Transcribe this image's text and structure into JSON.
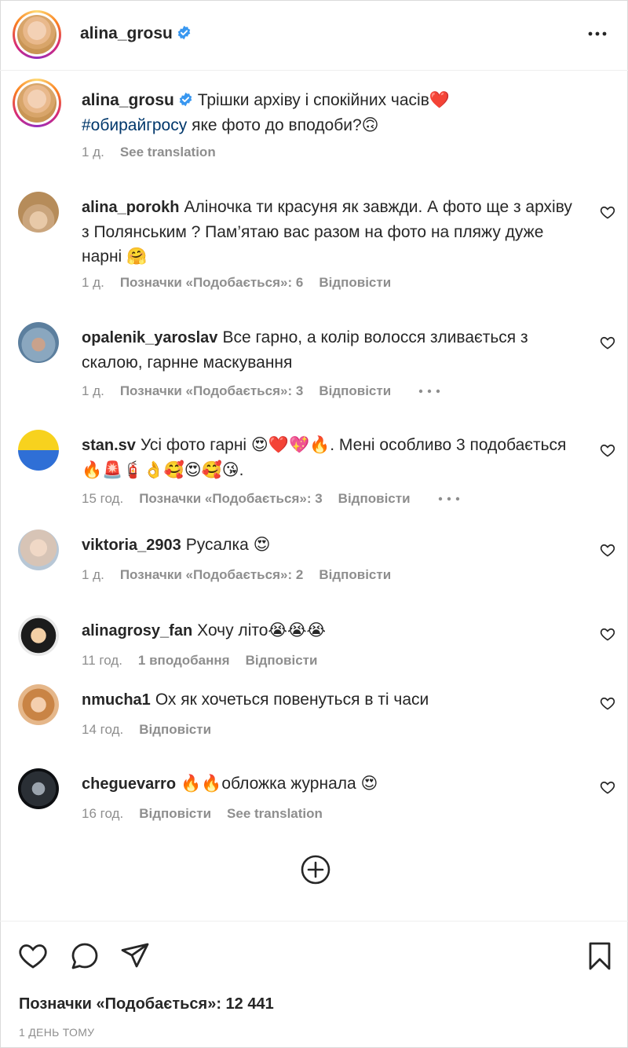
{
  "header": {
    "username": "alina_grosu",
    "more_icon": "more-horizontal-icon"
  },
  "caption": {
    "username": "alina_grosu",
    "text_line1": "Трішки архіву і спокійних часів❤️",
    "hashtag": "#обирайгросу",
    "text_line2": " яке фото до вподоби?🙃",
    "time": "1 д.",
    "see_translation": "See translation"
  },
  "comments": [
    {
      "username": "alina_porokh",
      "text": "Аліночка ти красуня як завжди. А фото ще з архіву з Полянським ? Пам’ятаю вас разом на фото на пляжу дуже нарні 🤗",
      "time": "1 д.",
      "likes": "Позначки «Подобається»: 6",
      "reply": "Відповісти"
    },
    {
      "username": "opalenik_yaroslav",
      "text": "Все гарно, а колір волосся зливається з скалою, гарнне маскування",
      "time": "1 д.",
      "likes": "Позначки «Подобається»: 3",
      "reply": "Відповісти"
    },
    {
      "username": "stan.sv",
      "text": "Усі фото гарні 😍❤️💖🔥. Мені особливо 3 подобається 🔥🚨🧯👌🥰😍🥰😘.",
      "time": "15 год.",
      "likes": "Позначки «Подобається»: 3",
      "reply": "Відповісти"
    },
    {
      "username": "viktoria_2903",
      "text": "Русалка 😍",
      "time": "1 д.",
      "likes": "Позначки «Подобається»: 2",
      "reply": "Відповісти"
    },
    {
      "username": "alinagrosy_fan",
      "text": "Хочу літо😭😭😭",
      "time": "11 год.",
      "likes": "1 вподобання",
      "reply": "Відповісти"
    },
    {
      "username": "nmucha1",
      "text": "Ох як хочеться повенуться в ті часи",
      "time": "14 год.",
      "reply": "Відповісти"
    },
    {
      "username": "cheguevarro",
      "text": "🔥🔥обложка журнала 😍",
      "time": "16 год.",
      "reply": "Відповісти",
      "see_translation": "See translation"
    }
  ],
  "footer": {
    "likes": "Позначки «Подобається»: 12 441",
    "time_ago": "1 ДЕНЬ ТОМУ"
  },
  "icons": {
    "heart": "heart-icon",
    "comment": "comment-icon",
    "share": "share-icon",
    "save": "bookmark-icon",
    "add": "add-circle-icon",
    "verified": "verified-badge-icon"
  },
  "colors": {
    "text": "#262626",
    "secondary": "#8e8e8e",
    "hashtag": "#00376b",
    "verified": "#3897f0"
  }
}
